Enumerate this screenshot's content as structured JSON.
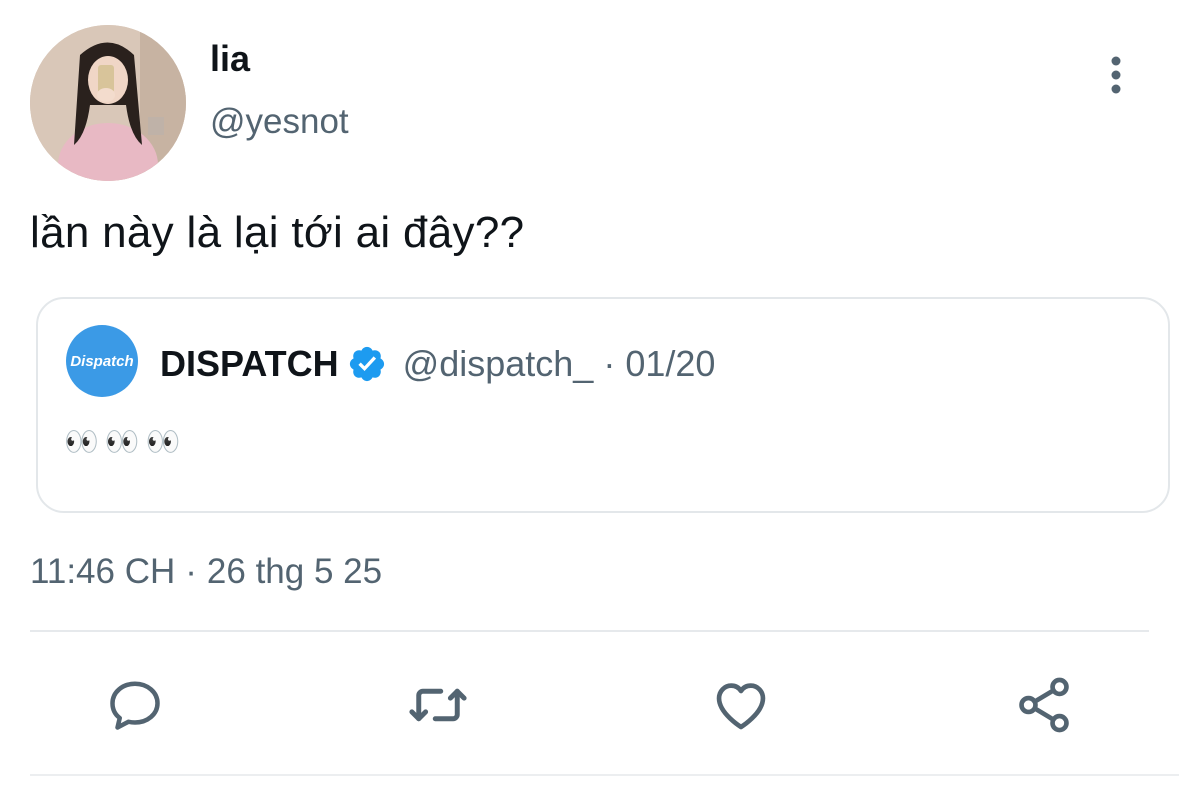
{
  "author": {
    "display_name": "lia",
    "handle": "@yesnot"
  },
  "tweet": {
    "text": "lần này là lại tới ai đây??",
    "time": "11:46 CH",
    "separator": "·",
    "date": "26 thg 5 25"
  },
  "quoted_tweet": {
    "avatar_text": "Dispatch",
    "display_name": "DISPATCH",
    "verified": true,
    "handle": "@dispatch_",
    "separator": "·",
    "date": "01/20",
    "text": "👀👀👀"
  },
  "actions": {
    "reply_icon": "reply-icon",
    "retweet_icon": "retweet-icon",
    "like_icon": "like-icon",
    "share_icon": "share-icon"
  },
  "colors": {
    "primary_text": "#0f1419",
    "secondary_text": "#536471",
    "verified_blue": "#1d9bf0",
    "dispatch_blue": "#3b9ae6",
    "border": "#e3e7ea"
  }
}
